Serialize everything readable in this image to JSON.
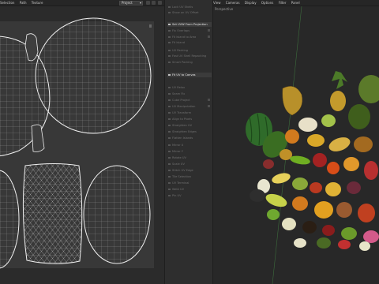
{
  "uv_editor": {
    "menu": [
      "Selection",
      "Path",
      "Texture"
    ],
    "mode_select": "Project",
    "chevron_icon": "chevron-down-icon"
  },
  "tools_panel": {
    "items": [
      {
        "label": "Lock UV Shells",
        "highlight": false
      },
      {
        "label": "Show on UV Offset",
        "highlight": false
      },
      {
        "label": "Set UVW From Projection",
        "highlight": true
      },
      {
        "label": "Fix Overlaps",
        "highlight": false
      },
      {
        "label": "Fit Island to Area",
        "highlight": false
      },
      {
        "label": "Fit Island",
        "highlight": false
      },
      {
        "label": "UV Packing",
        "highlight": false
      },
      {
        "label": "Fast UV Shell Repacking",
        "highlight": false
      },
      {
        "label": "Smart Packing",
        "highlight": false
      },
      {
        "label": "Fit UV to Canvas",
        "highlight": true
      },
      {
        "label": "UV Relax",
        "highlight": false
      },
      {
        "label": "Seam Fix",
        "highlight": false
      },
      {
        "label": "Cube Project",
        "highlight": false
      },
      {
        "label": "UV Manipulation",
        "highlight": false
      },
      {
        "label": "UV Transform",
        "highlight": false
      },
      {
        "label": "Align to Pixels",
        "highlight": false
      },
      {
        "label": "Straighten UV",
        "highlight": false
      },
      {
        "label": "Straighten Edges",
        "highlight": false
      },
      {
        "label": "Flatten Islands",
        "highlight": false
      },
      {
        "label": "Mirror X",
        "highlight": false
      },
      {
        "label": "Mirror Y",
        "highlight": false
      },
      {
        "label": "Rotate UV",
        "highlight": false
      },
      {
        "label": "Scale UV",
        "highlight": false
      },
      {
        "label": "Stitch UV Edge",
        "highlight": false
      },
      {
        "label": "Tile Selection",
        "highlight": false
      },
      {
        "label": "UV Terminal",
        "highlight": false
      },
      {
        "label": "Weld UV",
        "highlight": false
      },
      {
        "label": "Pin UV",
        "highlight": false
      }
    ]
  },
  "viewport": {
    "menu": [
      "View",
      "Cameras",
      "Display",
      "Options",
      "Filter",
      "Panel"
    ],
    "label": "Perspective"
  },
  "colors": {
    "accent": "#e0a020",
    "uv_line": "#e6e6e6"
  }
}
